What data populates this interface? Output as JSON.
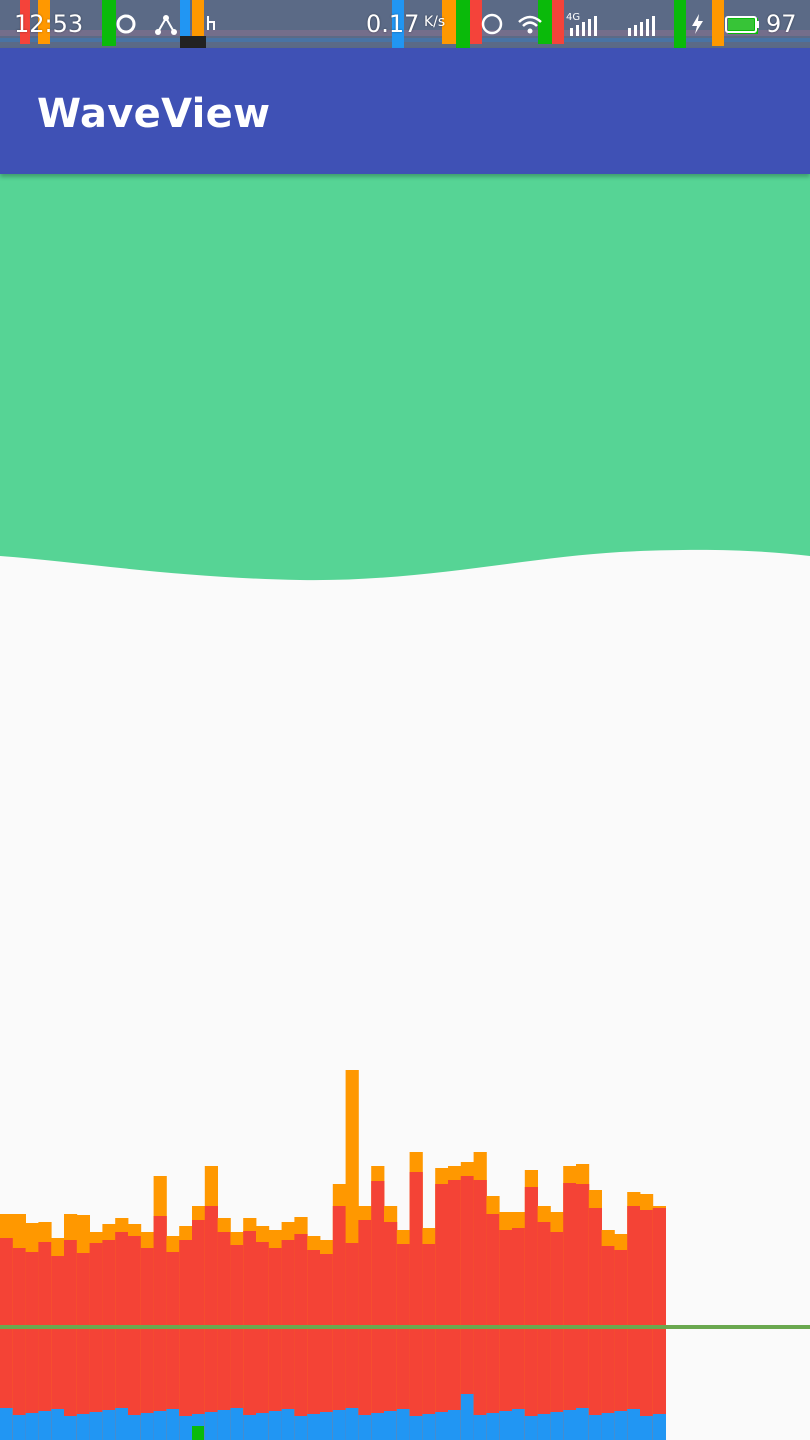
{
  "status_bar": {
    "time": "12:53",
    "network_speed": "0.17",
    "network_speed_unit": "K/s",
    "battery_percent": "97",
    "icons": [
      "sync-icon",
      "usb-debug-icon",
      "touch-icon",
      "wifi-icon",
      "4g-icon",
      "signal-icon",
      "signal-icon",
      "charging-icon",
      "battery-icon"
    ]
  },
  "app_bar": {
    "title": "WaveView"
  },
  "wave": {
    "color": "#56d495"
  },
  "gpu_profiler": {
    "colors": {
      "red": "#f44336",
      "orange": "#ff9800",
      "blue": "#2196f3",
      "threshold": "#6aa84f"
    }
  }
}
